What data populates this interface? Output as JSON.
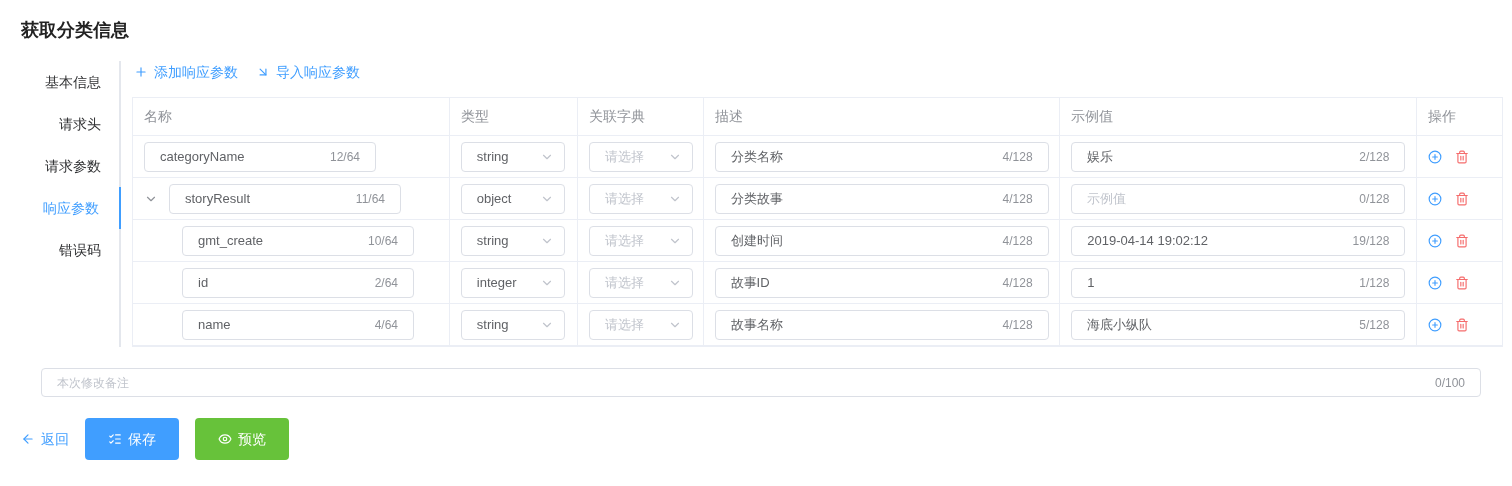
{
  "title": "获取分类信息",
  "nav": [
    {
      "label": "基本信息",
      "selected": false
    },
    {
      "label": "请求头",
      "selected": false
    },
    {
      "label": "请求参数",
      "selected": false
    },
    {
      "label": "响应参数",
      "selected": true
    },
    {
      "label": "错误码",
      "selected": false
    }
  ],
  "toolbar": [
    {
      "kind": "add",
      "label": "添加响应参数"
    },
    {
      "kind": "import",
      "label": "导入响应参数"
    }
  ],
  "table": {
    "columns": [
      "名称",
      "类型",
      "关联字典",
      "描述",
      "示例值",
      "操作"
    ],
    "rows": [
      {
        "name": "categoryName",
        "name_count": "12/64",
        "type": "string",
        "dictionary_placeholder": "请选择",
        "description": "分类名称",
        "description_count": "4/128",
        "example": "娱乐",
        "example_count": "2/128"
      },
      {
        "name": "storyResult",
        "name_count": "11/64",
        "type": "object",
        "dictionary_placeholder": "请选择",
        "description": "分类故事",
        "description_count": "4/128",
        "example_placeholder": "示例值",
        "example_count": "0/128",
        "expanded": true,
        "children": [
          {
            "name": "gmt_create",
            "name_count": "10/64",
            "type": "string",
            "dictionary_placeholder": "请选择",
            "description": "创建时间",
            "description_count": "4/128",
            "example": "2019-04-14 19:02:12",
            "example_count": "19/128"
          },
          {
            "name": "id",
            "name_count": "2/64",
            "type": "integer",
            "dictionary_placeholder": "请选择",
            "description": "故事ID",
            "description_count": "4/128",
            "example": "1",
            "example_count": "1/128"
          },
          {
            "name": "name",
            "name_count": "4/64",
            "type": "string",
            "dictionary_placeholder": "请选择",
            "description": "故事名称",
            "description_count": "4/128",
            "example": "海底小纵队",
            "example_count": "5/128"
          }
        ]
      }
    ]
  },
  "remark": {
    "placeholder": "本次修改备注",
    "count": "0/100"
  },
  "buttons": [
    {
      "kind": "back",
      "label": "返回"
    },
    {
      "kind": "save",
      "label": "保存"
    },
    {
      "kind": "preview",
      "label": "预览"
    }
  ]
}
